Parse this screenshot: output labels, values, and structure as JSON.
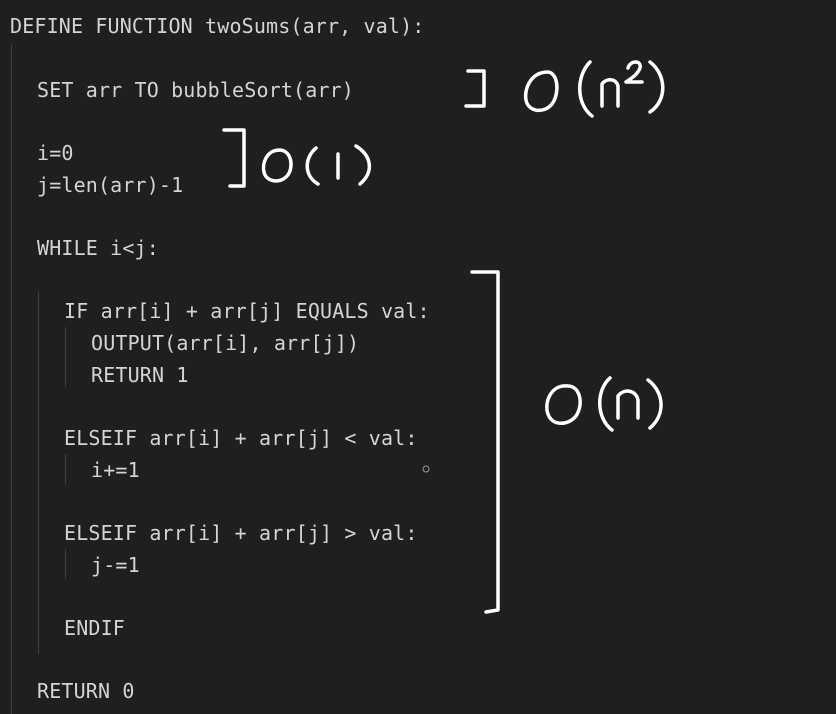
{
  "code": {
    "lines": [
      "DEFINE FUNCTION twoSums(arr, val):",
      "SET arr TO bubbleSort(arr)",
      "i=0",
      "j=len(arr)-1",
      "WHILE i<j:",
      "IF arr[i] + arr[j] EQUALS val:",
      "OUTPUT(arr[i], arr[j])",
      "RETURN 1",
      "ELSEIF arr[i] + arr[j] < val:",
      "i+=1",
      "ELSEIF arr[i] + arr[j] > val:",
      "j-=1",
      "ENDIF",
      "RETURN 0"
    ]
  },
  "annotations": {
    "bubble_sort_complexity": "O(n²)",
    "init_complexity": "O(1)",
    "loop_complexity": "O(n)"
  },
  "colors": {
    "background": "#1f1f1f",
    "code_text": "#d4d4d4",
    "indent_guide": "#404040",
    "ink": "#ffffff"
  }
}
